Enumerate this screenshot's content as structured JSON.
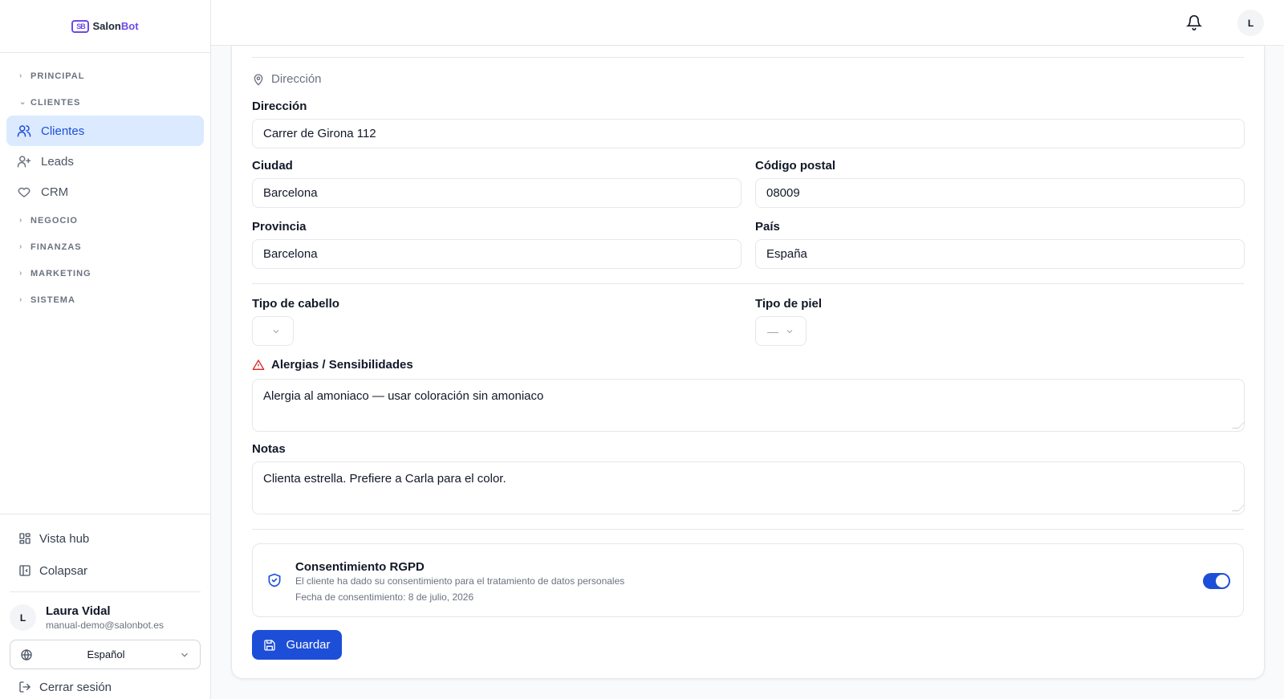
{
  "app": {
    "logo_prefix": "Salon",
    "logo_accent": "Bot",
    "logo_mark": "SB"
  },
  "sidebar": {
    "sections": {
      "principal": "PRINCIPAL",
      "clientes": "CLIENTES",
      "negocio": "NEGOCIO",
      "finanzas": "FINANZAS",
      "marketing": "MARKETING",
      "sistema": "SISTEMA"
    },
    "items": {
      "clientes": "Clientes",
      "leads": "Leads",
      "crm": "CRM"
    },
    "bottom": {
      "hub": "Vista hub",
      "collapse": "Colapsar",
      "logout": "Cerrar sesión"
    },
    "user": {
      "initial": "L",
      "name": "Laura Vidal",
      "email": "manual-demo@salonbot.es"
    },
    "language": "Español"
  },
  "header": {
    "avatar_initial": "L"
  },
  "form": {
    "address_section": "Dirección",
    "address_label": "Dirección",
    "address_value": "Carrer de Girona 112",
    "city_label": "Ciudad",
    "city_value": "Barcelona",
    "postal_label": "Código postal",
    "postal_value": "08009",
    "province_label": "Provincia",
    "province_value": "Barcelona",
    "country_label": "País",
    "country_value": "España",
    "hair_label": "Tipo de cabello",
    "hair_value": "",
    "skin_label": "Tipo de piel",
    "skin_value": "—",
    "allergies_label": "Alergias / Sensibilidades",
    "allergies_value": "Alergia al amoniaco — usar coloración sin amoniaco",
    "notes_label": "Notas",
    "notes_value": "Clienta estrella. Prefiere a Carla para el color.",
    "consent_title": "Consentimiento RGPD",
    "consent_desc": "El cliente ha dado su consentimiento para el tratamiento de datos personales",
    "consent_date": "Fecha de consentimiento: 8 de julio, 2026",
    "consent_enabled": true,
    "save_label": "Guardar"
  },
  "colors": {
    "accent": "#1d4ed8",
    "brand": "#6d4be8",
    "warning": "#dc2626"
  }
}
